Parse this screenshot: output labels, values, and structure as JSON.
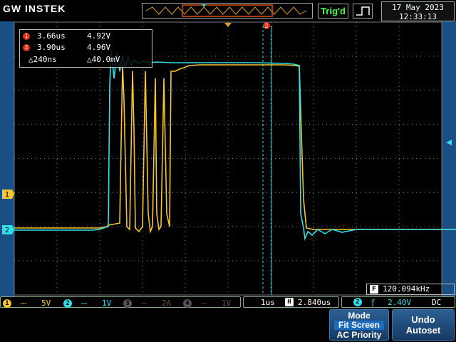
{
  "brand": "GW INSTEK",
  "trigger_status": "Trig'd",
  "date": "17 May 2023",
  "time": "12:33:13",
  "colors": {
    "ch1": "#f7c52c",
    "ch2": "#2ee1e8",
    "cursor": "#e03010",
    "grid": "#888888",
    "panel": "#1a4f86"
  },
  "cursors": {
    "cursor1": {
      "marker": "1",
      "time": "3.66us",
      "volt": "4.92V"
    },
    "cursor2": {
      "marker": "2",
      "time": "3.90us",
      "volt": "4.96V"
    },
    "delta": {
      "time": "△240ns",
      "volt": "△40.0mV"
    }
  },
  "frequency": {
    "badge": "F",
    "value": "120.094kHz"
  },
  "markers": {
    "ch1": "1",
    "ch2": "2",
    "cursor2": "2"
  },
  "channels": {
    "ch1": {
      "num": "1",
      "scale": "5V"
    },
    "ch2": {
      "num": "2",
      "scale": "1V"
    },
    "ch3": {
      "num": "3",
      "scale": "2A"
    },
    "ch4": {
      "num": "4",
      "scale": "1V"
    }
  },
  "timebase": {
    "scale": "1us",
    "h_badge": "H",
    "position": "2.840us"
  },
  "trigger": {
    "source": "2",
    "slope_icon": "ƒ",
    "level": "2.40V",
    "coupling": "DC"
  },
  "softkeys": {
    "mode": {
      "title": "Mode",
      "option_selected": "Fit Screen",
      "option_other": "AC Priority"
    },
    "undo": {
      "line1": "Undo",
      "line2": "Autoset"
    }
  }
}
